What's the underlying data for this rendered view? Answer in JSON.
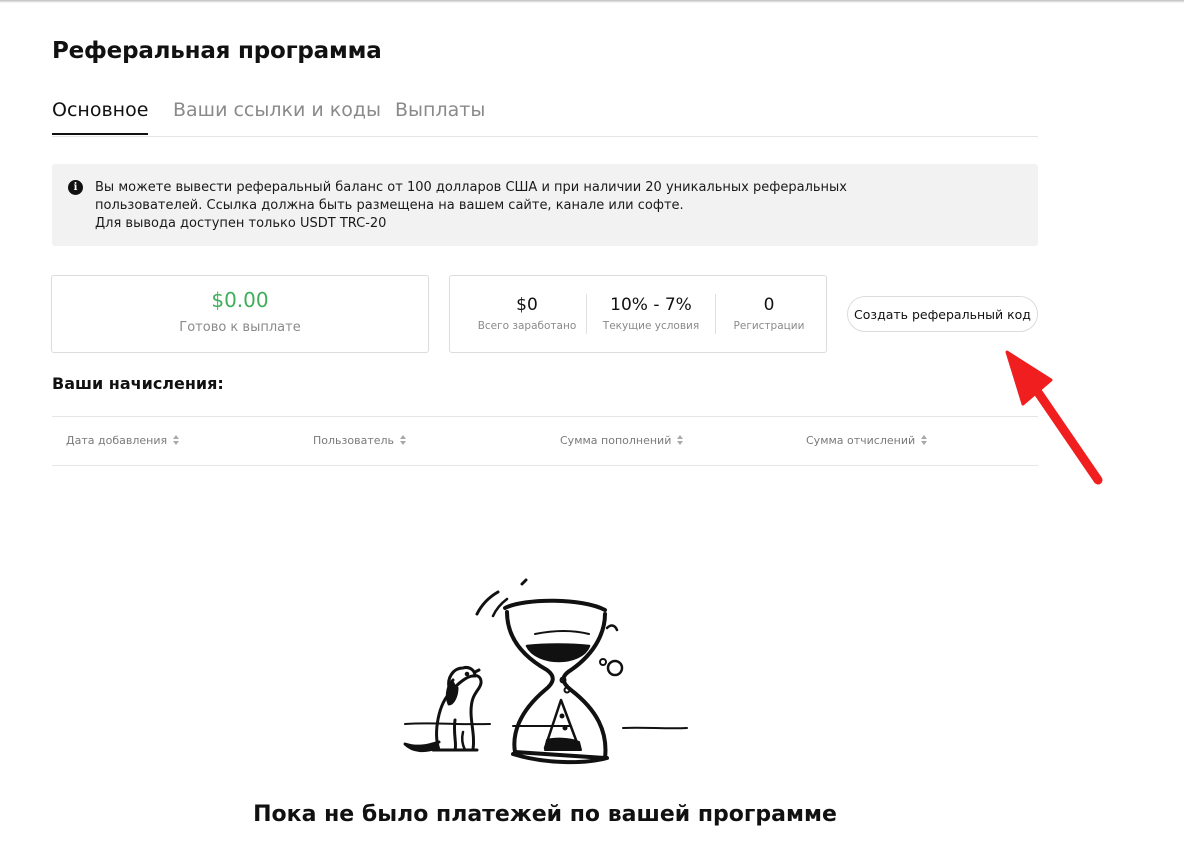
{
  "page": {
    "title": "Реферальная программа"
  },
  "tabs": [
    {
      "label": "Основное",
      "active": true
    },
    {
      "label": "Ваши ссылки и коды",
      "active": false
    },
    {
      "label": "Выплаты",
      "active": false
    }
  ],
  "notice": {
    "icon": "info-icon",
    "lines": [
      "Вы можете вывести реферальный баланс от 100 долларов США и при наличии 20 уникальных реферальных",
      "пользователей. Ссылка должна быть размещена на вашем сайте, канале или софте.",
      "Для вывода доступен только USDT TRC-20"
    ]
  },
  "balance": {
    "value": "$0.00",
    "label": "Готово к выплате",
    "value_color": "#3fae5a"
  },
  "stats": [
    {
      "value": "$0",
      "label": "Всего заработано"
    },
    {
      "value": "10% - 7%",
      "label": "Текущие условия"
    },
    {
      "value": "0",
      "label": "Регистрации"
    }
  ],
  "create_button": {
    "label": "Создать реферальный код"
  },
  "accruals": {
    "title": "Ваши начисления:",
    "columns": [
      {
        "label": "Дата добавления",
        "icon": "sort-icon"
      },
      {
        "label": "Пользователь",
        "icon": "sort-icon"
      },
      {
        "label": "Сумма пополнений",
        "icon": "sort-icon"
      },
      {
        "label": "Сумма отчислений",
        "icon": "sort-icon"
      }
    ]
  },
  "annotation": {
    "arrow_color": "#f01e1e"
  },
  "empty_state": {
    "illustration": "dog-hourglass-illustration",
    "title": "Пока не было платежей по вашей программе"
  }
}
